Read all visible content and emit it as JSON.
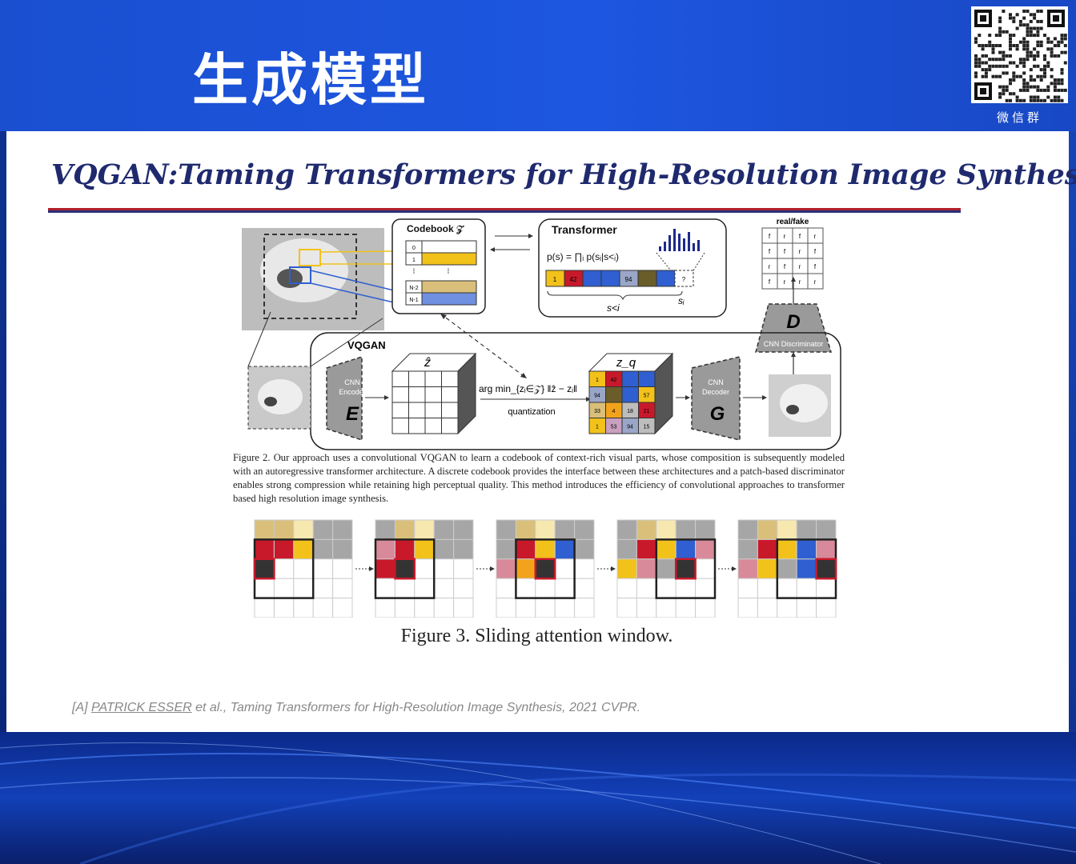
{
  "slide": {
    "title": "生成模型",
    "qr_label": "微信群"
  },
  "paper_title": "VQGAN:Taming Transformers for High-Resolution Image Synthesis",
  "figure2": {
    "codebook_title": "Codebook 𝒵",
    "codebook_rows": [
      "0",
      "1",
      "N-2",
      "N-1"
    ],
    "transformer_title": "Transformer",
    "transformer_formula": "p(s) = ∏ᵢ p(sᵢ|s<ᵢ)",
    "sequence": [
      "1",
      "42",
      "",
      "",
      "94",
      "",
      "",
      "?"
    ],
    "s_less": "s<i",
    "s_i": "sᵢ",
    "real_fake_label": "real/fake",
    "real_fake_grid": [
      [
        "f",
        "r",
        "f",
        "r"
      ],
      [
        "f",
        "f",
        "r",
        "f"
      ],
      [
        "r",
        "f",
        "r",
        "f"
      ],
      [
        "f",
        "r",
        "r",
        "r"
      ]
    ],
    "discriminator_letter": "D",
    "discriminator_label": "CNN Discriminator",
    "vqgan_label": "VQGAN",
    "encoder_label": "CNN Encoder",
    "encoder_letter": "E",
    "zhat_label": "ẑ",
    "argmin_label": "arg min_{zᵢ∈𝒵} ‖ẑ − zᵢ‖",
    "quantization_label": "quantization",
    "zq_label": "z_q",
    "zq_grid": [
      [
        "1",
        "42",
        "",
        ""
      ],
      [
        "94",
        "",
        "",
        "57"
      ],
      [
        "33",
        "4",
        "18",
        "21"
      ],
      [
        "1",
        "53",
        "94",
        "15"
      ]
    ],
    "decoder_label": "CNN Decoder",
    "decoder_letter": "G",
    "caption": "Figure 2. Our approach uses a convolutional VQGAN to learn a codebook of context-rich visual parts, whose composition is subsequently modeled with an autoregressive transformer architecture. A discrete codebook provides the interface between these architectures and a patch-based discriminator enables strong compression while retaining high perceptual quality. This method introduces the efficiency of convolutional approaches to transformer based high resolution image synthesis."
  },
  "figure3": {
    "caption": "Figure 3. Sliding attention window."
  },
  "reference": {
    "prefix": "[A] ",
    "author": "PATRICK ESSER",
    "rest": " et al., Taming Transformers for High-Resolution Image Synthesis, 2021 CVPR."
  },
  "colors": {
    "title_blue": "#1f2a6e",
    "rule_red": "#b0202a",
    "code_yellow": "#f2c21b",
    "code_blue": "#2f5fd0",
    "code_red": "#c8192a"
  }
}
